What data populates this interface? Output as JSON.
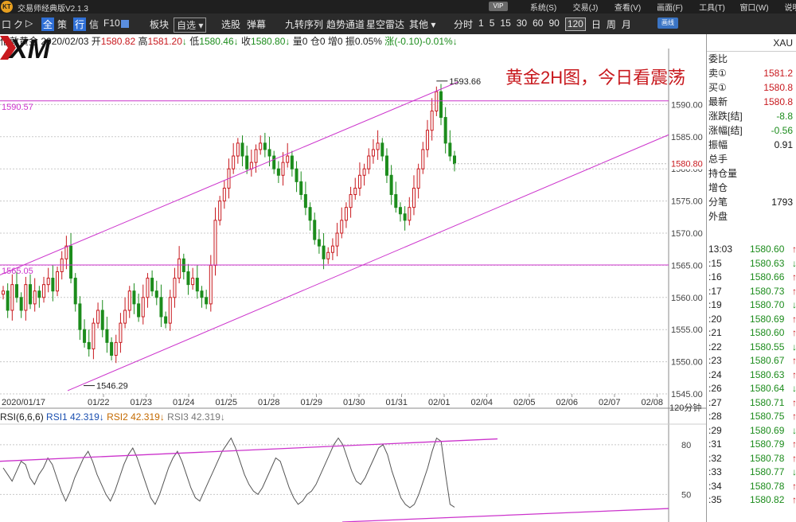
{
  "titlebar": {
    "logo_text": "KT",
    "app_title": "交易师经典版V2.1.3",
    "vip_label": "VIP",
    "menus": [
      "系统(S)",
      "交易(J)",
      "查看(V)",
      "画面(F)",
      "工具(T)",
      "窗口(W)",
      "说明书"
    ]
  },
  "toolbar": {
    "left_icons": [
      "口",
      "ク",
      "▷"
    ],
    "btn_all": "全",
    "btn_strategy": "策",
    "btn_quote": "行",
    "btn_info": "信",
    "btn_f10": "F10",
    "btn_board": "板块",
    "select_watch": "自选",
    "btn_pick": "选股",
    "btn_popup": "弹幕",
    "btn_nine": "九转序列",
    "btn_trend": "趋势通道",
    "btn_radar": "星空雷达",
    "btn_other": "其他",
    "periods": [
      "分时",
      "1",
      "5",
      "15",
      "30",
      "60",
      "90",
      "120",
      "日",
      "周",
      "月"
    ],
    "active_period": "120",
    "btn_draw": "画线"
  },
  "quote": {
    "name": "伦敦黄金",
    "date": "2020/02/03",
    "open_label": "开",
    "open": "1580.82",
    "high_label": "高",
    "high": "1581.20",
    "low_label": "低",
    "low": "1580.46",
    "close_label": "收",
    "close": "1580.80",
    "vol_label": "量",
    "vol": "0",
    "oi_label": "仓",
    "oi": "0",
    "inc_label": "增",
    "inc": "0",
    "amp_label": "振",
    "amp": "0.05%",
    "chg_label": "涨",
    "chg": "(-0.10)",
    "chg_pct": "-0.01%"
  },
  "headline": "黄金2H图，今日看震荡",
  "timeframe_label": "120分钟",
  "rsi": {
    "title": "RSI(6,6,6)",
    "rsi1": "RSI1 42.319",
    "rsi2": "RSI2 42.319",
    "rsi3": "RSI3 42.319",
    "levels": [
      "80",
      "50"
    ]
  },
  "watermark": "XM",
  "panel": {
    "symbol": "XAU",
    "fields": [
      {
        "label": "委比",
        "value": ""
      },
      {
        "label": "卖①",
        "value": "1581.2"
      },
      {
        "label": "买①",
        "value": "1580.8"
      },
      {
        "label": "最新",
        "value": "1580.8"
      },
      {
        "label": "涨跌[结]",
        "value": "-8.8"
      },
      {
        "label": "涨幅[结]",
        "value": "-0.56"
      },
      {
        "label": "振幅",
        "value": "0.91"
      },
      {
        "label": "总手",
        "value": ""
      },
      {
        "label": "持仓量",
        "value": ""
      },
      {
        "label": "增仓",
        "value": ""
      },
      {
        "label": "分笔",
        "value": "1793"
      },
      {
        "label": "外盘",
        "value": ""
      }
    ],
    "ticks": [
      {
        "t": "13:03",
        "p": "1580.60"
      },
      {
        "t": ":15",
        "p": "1580.63"
      },
      {
        "t": ":16",
        "p": "1580.66"
      },
      {
        "t": ":17",
        "p": "1580.73"
      },
      {
        "t": ":19",
        "p": "1580.70"
      },
      {
        "t": ":20",
        "p": "1580.69"
      },
      {
        "t": ":21",
        "p": "1580.60"
      },
      {
        "t": ":22",
        "p": "1580.55"
      },
      {
        "t": ":23",
        "p": "1580.67"
      },
      {
        "t": ":24",
        "p": "1580.63"
      },
      {
        "t": ":26",
        "p": "1580.64"
      },
      {
        "t": ":27",
        "p": "1580.71"
      },
      {
        "t": ":28",
        "p": "1580.75"
      },
      {
        "t": ":29",
        "p": "1580.69"
      },
      {
        "t": ":31",
        "p": "1580.79"
      },
      {
        "t": ":32",
        "p": "1580.78"
      },
      {
        "t": ":33",
        "p": "1580.77"
      },
      {
        "t": ":34",
        "p": "1580.78"
      },
      {
        "t": ":35",
        "p": "1580.82"
      }
    ]
  },
  "colors": {
    "up": "#c8191e",
    "down": "#1c8c1c",
    "channel": "#cc33cc",
    "grid": "#c8c8c8",
    "rsi_line": "#555555"
  },
  "chart_data": {
    "type": "candlestick",
    "price_axis": {
      "min": 1545,
      "max": 1595,
      "ticks": [
        "1545.00",
        "1550.00",
        "1555.00",
        "1560.00",
        "1565.00",
        "1570.00",
        "1575.00",
        "1580.00",
        "1585.00",
        "1590.00"
      ]
    },
    "last_price_label": "1580.80",
    "date_labels": [
      "2020/01/17",
      "01/22",
      "01/23",
      "01/24",
      "01/25",
      "01/28",
      "01/29",
      "01/30",
      "01/31",
      "02/01",
      "02/04",
      "02/05",
      "02/06",
      "02/07",
      "02/08"
    ],
    "horizontal_levels": [
      {
        "value": 1590.57,
        "label": "1590.57"
      },
      {
        "value": 1565.05,
        "label": "1565.05"
      }
    ],
    "annotations": [
      {
        "value": 1593.66,
        "label": "1593.66"
      },
      {
        "value": 1546.29,
        "label": "1546.29"
      }
    ],
    "close_path": [
      1561,
      1558,
      1562,
      1560,
      1558,
      1562,
      1559,
      1561,
      1560,
      1562,
      1563,
      1561,
      1564,
      1566,
      1568,
      1563,
      1559,
      1555,
      1553,
      1552,
      1556,
      1558,
      1555,
      1553,
      1551,
      1553,
      1556,
      1558,
      1561,
      1559,
      1557,
      1560,
      1563,
      1561,
      1560,
      1557,
      1556,
      1560,
      1563,
      1566,
      1564,
      1562,
      1563,
      1561,
      1560,
      1559,
      1565,
      1572,
      1575,
      1577,
      1580,
      1582,
      1584,
      1582,
      1580,
      1581,
      1583,
      1584,
      1583,
      1582,
      1580,
      1579,
      1581,
      1582,
      1580,
      1578,
      1576,
      1574,
      1572,
      1569,
      1568,
      1566,
      1567,
      1568,
      1570,
      1572,
      1574,
      1576,
      1577,
      1579,
      1580,
      1582,
      1583,
      1584,
      1582,
      1579,
      1576,
      1574,
      1573,
      1572,
      1574,
      1577,
      1580,
      1583,
      1586,
      1589,
      1592,
      1588,
      1584,
      1582,
      1580.8
    ],
    "rsi_series": {
      "name": "RSI1",
      "values": [
        66,
        62,
        58,
        64,
        70,
        68,
        60,
        56,
        62,
        66,
        72,
        68,
        60,
        52,
        46,
        52,
        60,
        66,
        72,
        76,
        70,
        62,
        56,
        50,
        46,
        52,
        60,
        68,
        74,
        78,
        72,
        64,
        56,
        48,
        44,
        50,
        58,
        66,
        72,
        76,
        70,
        62,
        54,
        48,
        46,
        52,
        58,
        64,
        70,
        76,
        80,
        84,
        78,
        70,
        62,
        56,
        52,
        50,
        54,
        60,
        66,
        72,
        70,
        62,
        54,
        48,
        44,
        46,
        50,
        52,
        56,
        62,
        68,
        74,
        80,
        84,
        80,
        72,
        64,
        58,
        56,
        60,
        66,
        72,
        78,
        80,
        74,
        64,
        56,
        48,
        44,
        42,
        44,
        50,
        58,
        66,
        76,
        84,
        82,
        62,
        44,
        42.3
      ]
    },
    "rsi_levels": [
      80,
      50
    ]
  }
}
